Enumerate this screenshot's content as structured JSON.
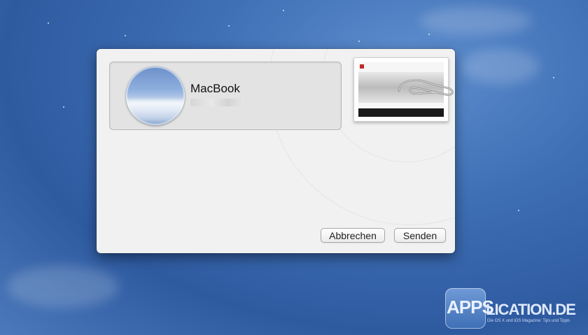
{
  "sheet": {
    "recipient": {
      "device_name": "MacBook"
    },
    "buttons": {
      "cancel_label": "Abbrechen",
      "send_label": "Senden"
    }
  },
  "watermark": {
    "part1": "APPS",
    "part2": "LICATION.DE",
    "tagline": "Die OS X und iOS Magazine: Tips und Tipps"
  },
  "colors": {
    "desktop_blue": "#3f6fb5",
    "sheet_bg": "#f1f1f1"
  }
}
